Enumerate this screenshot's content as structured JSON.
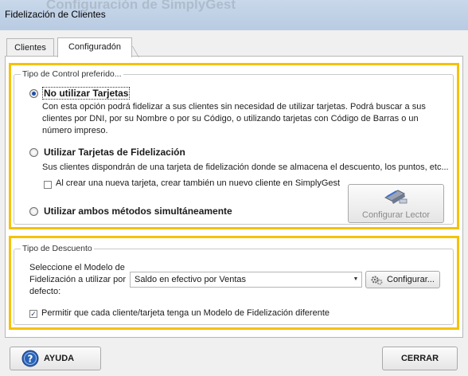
{
  "window": {
    "ghost_title": "Configuración de SimplyGest",
    "title": "Fidelización de Clientes"
  },
  "tabs": [
    {
      "label": "Clientes"
    },
    {
      "label": "Configuradón"
    }
  ],
  "control_group": {
    "legend": "Tipo de Control preferido...",
    "option1": {
      "label": "No utilizar Tarjetas",
      "description": "Con esta opción podrá fidelizar a sus clientes sin necesidad de utilizar tarjetas. Podrá buscar a sus clientes por DNI, por su Nombre o por su Código, o utilizando tarjetas con Código de Barras o un número impreso."
    },
    "option2": {
      "label": "Utilizar Tarjetas de Fidelización",
      "description": "Sus clientes dispondrán de una tarjeta de fidelización donde se almacena el descuento, los puntos, etc..."
    },
    "checkbox_create_client": "Al crear una nueva tarjeta, crear también un nuevo cliente en SimplyGest",
    "option3": {
      "label": "Utilizar ambos métodos simultáneamente"
    },
    "configure_reader": "Configurar Lector"
  },
  "discount_group": {
    "legend": "Tipo de Descuento",
    "model_label": "Seleccione el Modelo de Fidelización a utilizar por defecto:",
    "model_value": "Saldo en efectivo por Ventas",
    "configure_button": "Configurar...",
    "checkbox_different_model": "Permitir que cada cliente/tarjeta tenga un Modelo de Fidelización diferente"
  },
  "footer": {
    "help": "AYUDA",
    "close": "CERRAR"
  },
  "colors": {
    "highlight": "#f5c200",
    "radio_dot": "#1f4fa7",
    "help_icon": "#2a63b8"
  }
}
